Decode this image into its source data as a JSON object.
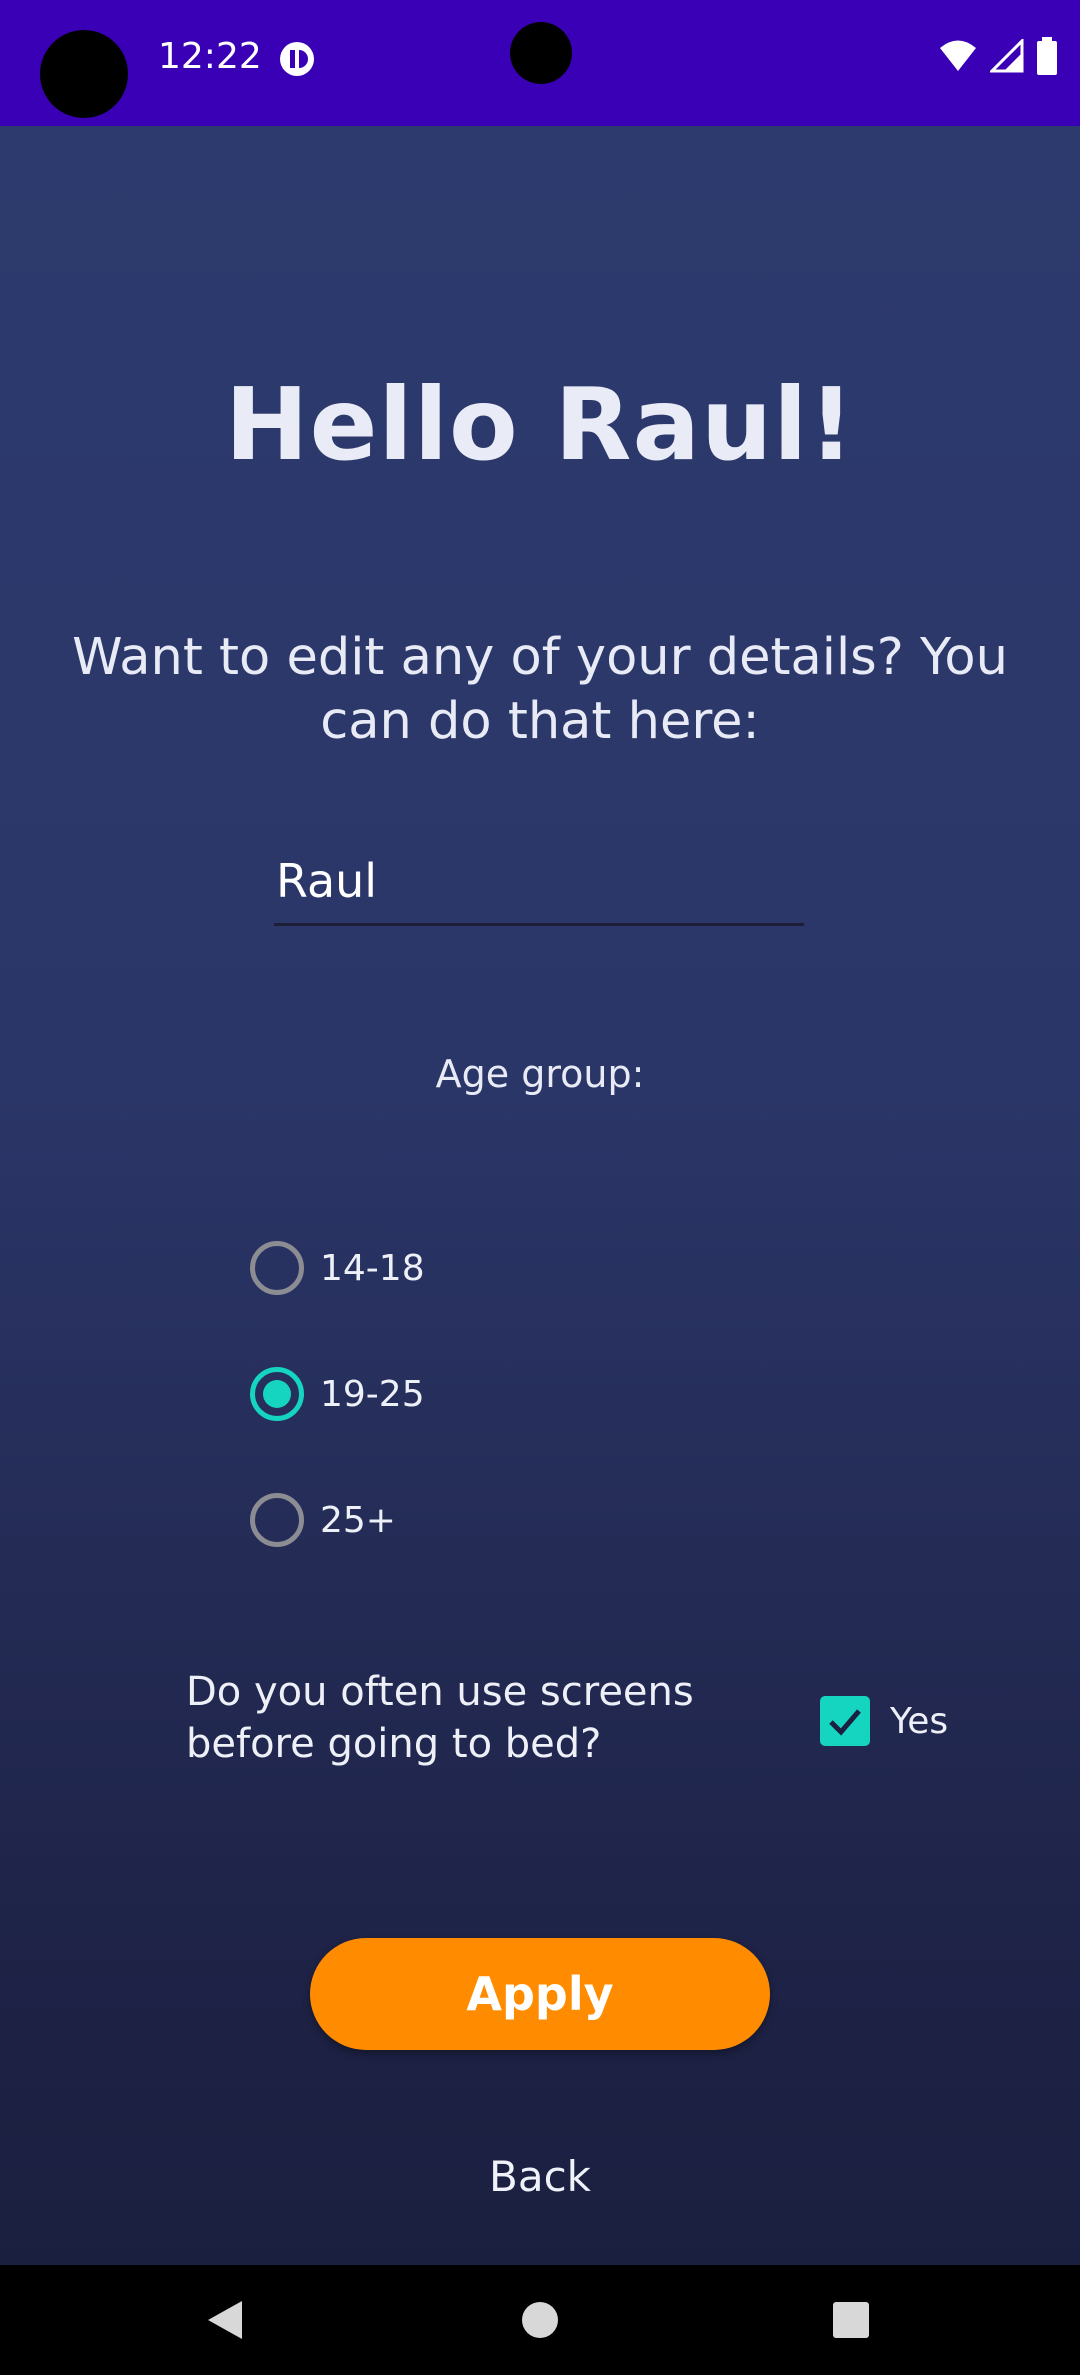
{
  "status_bar": {
    "time": "12:22",
    "app_icon": "app-notification-icon",
    "icons": [
      "wifi-icon",
      "signal-icon",
      "battery-icon"
    ],
    "background_color": "#3a00b6"
  },
  "screen": {
    "title": "Hello Raul!",
    "subtitle": "Want to edit any of your details? You can do that here:",
    "name_input": {
      "value": "Raul",
      "placeholder": ""
    },
    "age_group": {
      "label": "Age group:",
      "options": [
        {
          "label": "14-18",
          "selected": false
        },
        {
          "label": "19-25",
          "selected": true
        },
        {
          "label": "25+",
          "selected": false
        }
      ]
    },
    "screens_question": {
      "question": "Do you often use screens before going to bed?",
      "checkbox_label": "Yes",
      "checked": true
    },
    "apply_label": "Apply",
    "back_label": "Back"
  },
  "nav_bar": {
    "icons": [
      "back-triangle-icon",
      "home-circle-icon",
      "recents-square-icon"
    ]
  },
  "colors": {
    "accent_teal": "#15d4c0",
    "button_orange": "#ff8c00",
    "background_top": "#2d3a6d",
    "background_bottom": "#1b1f3f"
  }
}
